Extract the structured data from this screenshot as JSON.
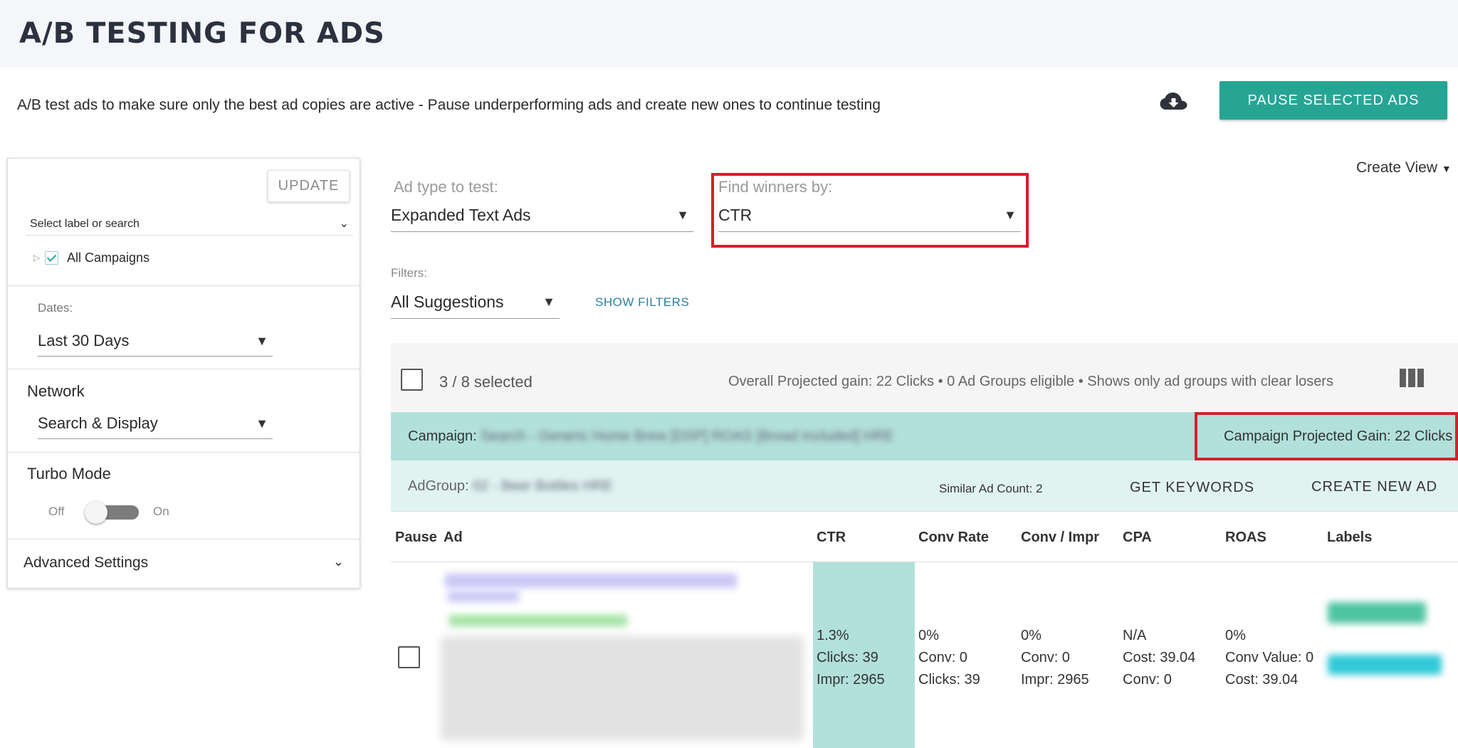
{
  "header": {
    "title": "A/B TESTING FOR ADS"
  },
  "subtitle": "A/B test ads to make sure only the best ad copies are active - Pause underperforming ads and create new ones to continue testing",
  "toolbar": {
    "download_icon": "cloud-download-icon",
    "pause_label": "PAUSE SELECTED ADS"
  },
  "sidebar": {
    "update_label": "UPDATE",
    "label_select": "Select label or search",
    "tree": {
      "all_campaigns": "All Campaigns",
      "checked": true
    },
    "dates": {
      "label": "Dates:",
      "value": "Last 30 Days"
    },
    "network": {
      "title": "Network",
      "value": "Search & Display"
    },
    "turbo": {
      "title": "Turbo Mode",
      "off": "Off",
      "on": "On",
      "enabled": false
    },
    "advanced": "Advanced Settings"
  },
  "main": {
    "ad_type": {
      "label": "Ad type to test:",
      "value": "Expanded Text Ads"
    },
    "winners": {
      "label": "Find winners by:",
      "value": "CTR"
    },
    "create_view": "Create View",
    "filters": {
      "label": "Filters:",
      "value": "All Suggestions",
      "show_filters": "SHOW FILTERS"
    },
    "selection": {
      "count": "3 / 8 selected",
      "gain": "Overall Projected gain: 22 Clicks • 0 Ad Groups eligible • Shows only ad groups with clear losers"
    },
    "campaign": {
      "label": "Campaign:",
      "name": "Search - Generic Home Brew [DSP] ROAS [Broad Included] HRE",
      "gain": "Campaign Projected Gain: 22 Clicks"
    },
    "adgroup": {
      "label": "AdGroup:",
      "name": "02 - Beer Bottles HRE",
      "similar": "Similar Ad Count: 2",
      "get_keywords": "GET KEYWORDS",
      "create_ad": "CREATE NEW AD"
    },
    "table": {
      "columns": [
        "Pause",
        "Ad",
        "CTR",
        "Conv Rate",
        "Conv / Impr",
        "CPA",
        "ROAS",
        "Labels"
      ],
      "row": {
        "ctr": "1.3%\nClicks: 39\nImpr: 2965",
        "conv_rate": "0%\nConv: 0\nClicks: 39",
        "conv_impr": "0%\nConv: 0\nImpr: 2965",
        "cpa": "N/A\nCost: 39.04\nConv: 0",
        "roas": "0%\nConv Value: 0\nCost: 39.04"
      }
    }
  },
  "colors": {
    "accent": "#27a594",
    "highlight": "#d4202a",
    "campaign_bg": "#b2e0db",
    "adgroup_bg": "#e1f3f1"
  }
}
